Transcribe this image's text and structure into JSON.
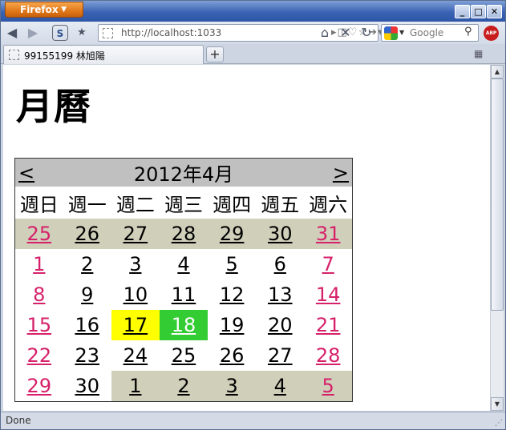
{
  "browser": {
    "menu_button": "Firefox",
    "window_controls": {
      "minimize": "_",
      "maximize": "□",
      "close": "✕"
    }
  },
  "nav": {
    "url": "http://localhost:1033",
    "search_placeholder": "Google"
  },
  "tab": {
    "title": "99155199 林旭陽",
    "new_tab": "+"
  },
  "page": {
    "title": "月曆"
  },
  "calendar": {
    "prev": "<",
    "next": ">",
    "caption": "2012年4月",
    "weekdays": [
      "週日",
      "週一",
      "週二",
      "週三",
      "週四",
      "週五",
      "週六"
    ],
    "weeks": [
      [
        {
          "d": "25",
          "other": true
        },
        {
          "d": "26",
          "other": true
        },
        {
          "d": "27",
          "other": true
        },
        {
          "d": "28",
          "other": true
        },
        {
          "d": "29",
          "other": true
        },
        {
          "d": "30",
          "other": true
        },
        {
          "d": "31",
          "other": true
        }
      ],
      [
        {
          "d": "1"
        },
        {
          "d": "2"
        },
        {
          "d": "3"
        },
        {
          "d": "4"
        },
        {
          "d": "5"
        },
        {
          "d": "6"
        },
        {
          "d": "7"
        }
      ],
      [
        {
          "d": "8"
        },
        {
          "d": "9"
        },
        {
          "d": "10"
        },
        {
          "d": "11"
        },
        {
          "d": "12"
        },
        {
          "d": "13"
        },
        {
          "d": "14"
        }
      ],
      [
        {
          "d": "15"
        },
        {
          "d": "16"
        },
        {
          "d": "17",
          "today": true
        },
        {
          "d": "18",
          "selected": true
        },
        {
          "d": "19"
        },
        {
          "d": "20"
        },
        {
          "d": "21"
        }
      ],
      [
        {
          "d": "22"
        },
        {
          "d": "23"
        },
        {
          "d": "24"
        },
        {
          "d": "25"
        },
        {
          "d": "26"
        },
        {
          "d": "27"
        },
        {
          "d": "28"
        }
      ],
      [
        {
          "d": "29"
        },
        {
          "d": "30"
        },
        {
          "d": "1",
          "other": true
        },
        {
          "d": "2",
          "other": true
        },
        {
          "d": "3",
          "other": true
        },
        {
          "d": "4",
          "other": true
        },
        {
          "d": "5",
          "other": true
        }
      ]
    ],
    "colors": {
      "weekend": "#d6216a",
      "today_bg": "#ffff00",
      "selected_bg": "#33cc33",
      "other_month_bg": "#cfcfba",
      "header_bg": "#c0c0c0"
    }
  },
  "status": {
    "text": "Done"
  }
}
